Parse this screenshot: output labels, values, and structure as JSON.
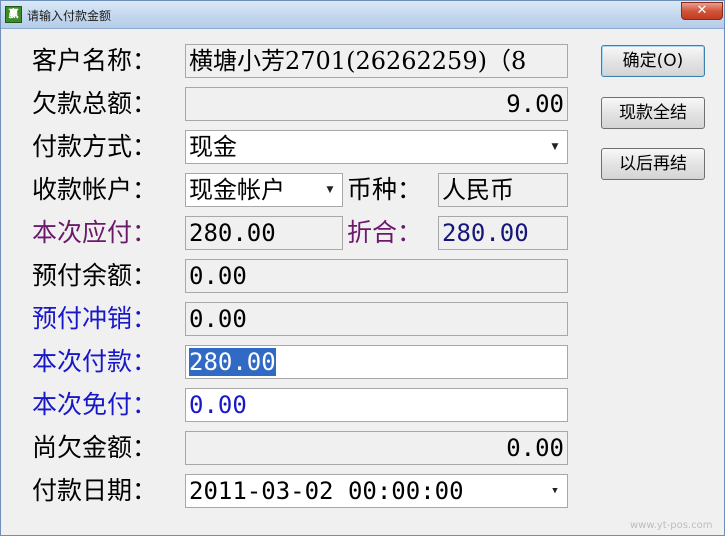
{
  "window": {
    "title": "请输入付款金额",
    "app_icon_text": "赢",
    "close_glyph": "✕"
  },
  "form": {
    "customer_name": {
      "label": "客户名称：",
      "value": "横塘小芳2701(26262259)（8"
    },
    "amount_owed": {
      "label": "欠款总额：",
      "value": "9.00"
    },
    "payment_method": {
      "label": "付款方式：",
      "value": "现金"
    },
    "receiving_account": {
      "label": "收款帐户：",
      "value": "现金帐户"
    },
    "currency": {
      "label": "币种：",
      "value": "人民币"
    },
    "amount_due_now": {
      "label": "本次应付：",
      "value": "280.00"
    },
    "converted": {
      "label": "折合：",
      "value": "280.00"
    },
    "prepaid_balance": {
      "label": "预付余额：",
      "value": "0.00"
    },
    "prepaid_offset": {
      "label": "预付冲销：",
      "value": "0.00"
    },
    "payment_now": {
      "label": "本次付款：",
      "value": "280.00"
    },
    "waived_now": {
      "label": "本次免付：",
      "value": "0.00"
    },
    "still_owed": {
      "label": "尚欠金额：",
      "value": "0.00"
    },
    "payment_date": {
      "label": "付款日期：",
      "value": "2011-03-02 00:00:00"
    }
  },
  "buttons": {
    "confirm": "确定(O)",
    "settle_cash": "现款全结",
    "settle_later": "以后再结"
  },
  "watermark": "www.yt-pos.com",
  "colors": {
    "purple_label": "#6b1a6b",
    "blue_label": "#1818c8",
    "selection": "#316ac5"
  }
}
